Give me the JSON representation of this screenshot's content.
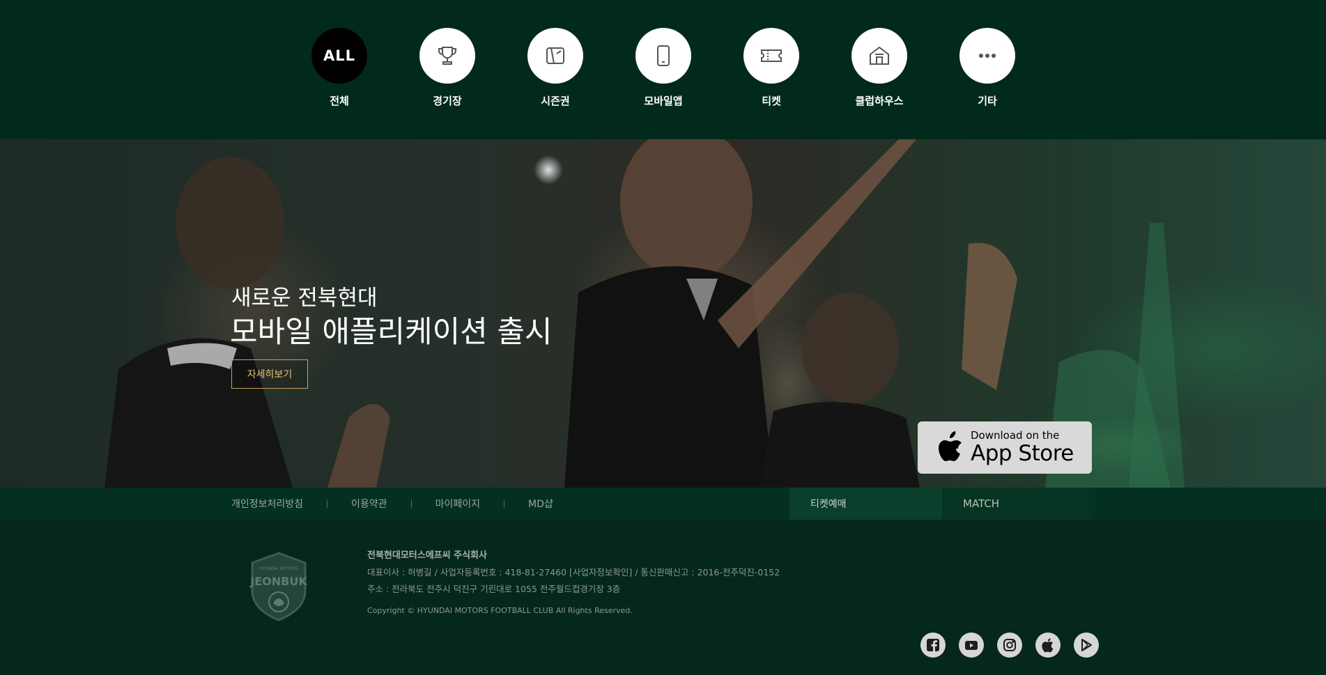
{
  "categories": [
    {
      "label": "ALL",
      "name": "전체",
      "icon": "all-icon",
      "active": true
    },
    {
      "label": "",
      "name": "경기장",
      "icon": "trophy-icon",
      "active": false
    },
    {
      "label": "",
      "name": "시즌권",
      "icon": "season-pass-icon",
      "active": false
    },
    {
      "label": "",
      "name": "모바일앱",
      "icon": "mobile-phone-icon",
      "active": false
    },
    {
      "label": "",
      "name": "티켓",
      "icon": "ticket-icon",
      "active": false
    },
    {
      "label": "",
      "name": "클럽하우스",
      "icon": "house-icon",
      "active": false
    },
    {
      "label": "",
      "name": "기타",
      "icon": "more-dots-icon",
      "active": false
    }
  ],
  "hero": {
    "subtitle": "새로운 전북현대",
    "title": "모바일 애플리케이션 출시",
    "button": "자세히보기",
    "appstore_small": "Download on the",
    "appstore_big": "App Store"
  },
  "footer_links": [
    "개인정보처리방침",
    "이용약관",
    "마이페이지",
    "MD샵"
  ],
  "tabs": {
    "ticket": "티켓예매",
    "match": "MATCH"
  },
  "footer": {
    "logo_text": "JEONBUK",
    "logo_small": "HYUNDAI MOTORS",
    "company": "전북현대모터스에프씨 주식회사",
    "info1": "대표이사 : 허병길 / 사업자등록번호 : 418-81-27460 [사업자정보확인] / 통신판매신고 : 2016-전주덕진-0152",
    "info2": "주소 : 전라북도 전주시 덕진구 기린대로 1055 전주월드컵경기장 3층",
    "copyright": "Copyright © HYUNDAI MOTORS FOOTBALL CLUB All Rights Reserved."
  },
  "social": [
    "facebook-icon",
    "youtube-icon",
    "instagram-icon",
    "apple-icon",
    "google-play-icon"
  ],
  "colors": {
    "nav_bg": "#022a1c",
    "footer_bg": "#06271b",
    "accent_gold": "#c8a25a",
    "active_black": "#000000"
  }
}
